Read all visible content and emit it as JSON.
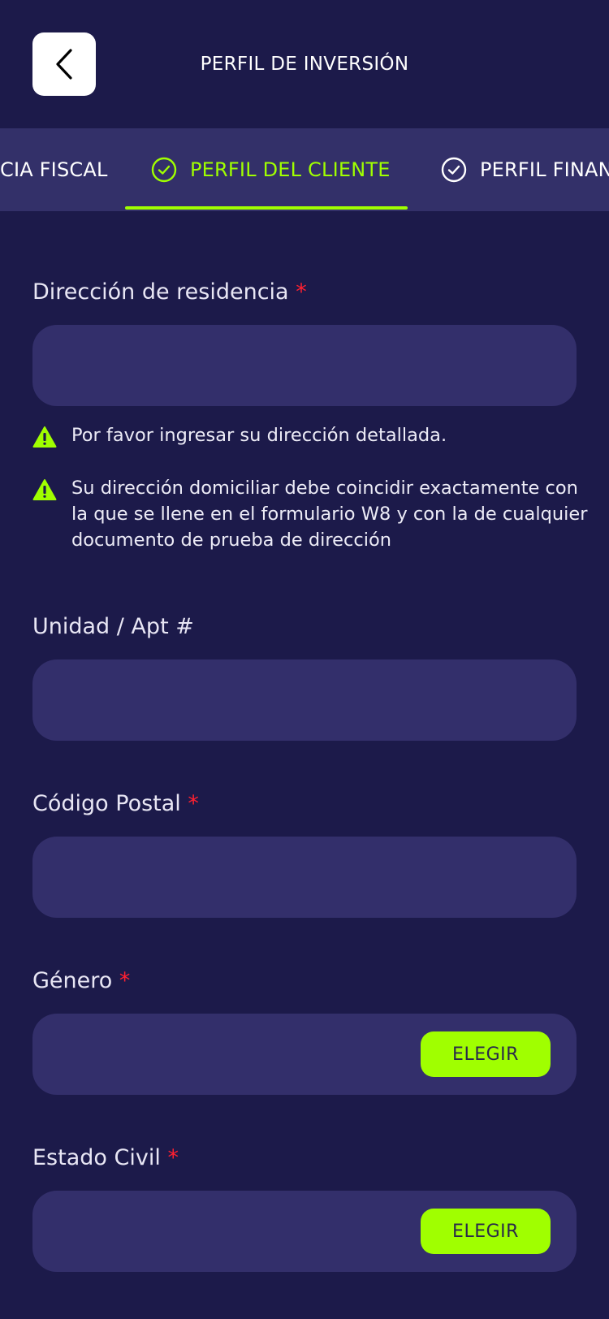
{
  "header": {
    "title": "PERFIL DE INVERSIÓN",
    "back_icon": "chevron-left-icon"
  },
  "tabs": [
    {
      "label": "CIA FISCAL",
      "state": "partial"
    },
    {
      "label": "PERFIL DEL CLIENTE",
      "state": "active",
      "icon": "check-circle-icon"
    },
    {
      "label": "PERFIL FINAN",
      "state": "inactive",
      "icon": "check-circle-icon"
    }
  ],
  "colors": {
    "background": "#1c1a4a",
    "tabbar": "#333069",
    "field": "#332f6b",
    "accent": "#a0ff00",
    "required": "#ff2030"
  },
  "form": {
    "required_mark": "*",
    "address": {
      "label": "Dirección de residencia",
      "value": "",
      "placeholder": "",
      "warnings": [
        "Por favor ingresar su dirección detallada.",
        "Su dirección domiciliar debe coincidir exactamente con la que se llene en el formulario W8 y con la de cualquier documento de prueba de dirección"
      ]
    },
    "unit": {
      "label": "Unidad / Apt #",
      "value": "",
      "placeholder": ""
    },
    "postal": {
      "label": "Código Postal",
      "value": "",
      "placeholder": ""
    },
    "gender": {
      "label": "Género",
      "value": "",
      "button": "ELEGIR"
    },
    "civil": {
      "label": "Estado Civil",
      "value": "",
      "button": "ELEGIR"
    }
  }
}
